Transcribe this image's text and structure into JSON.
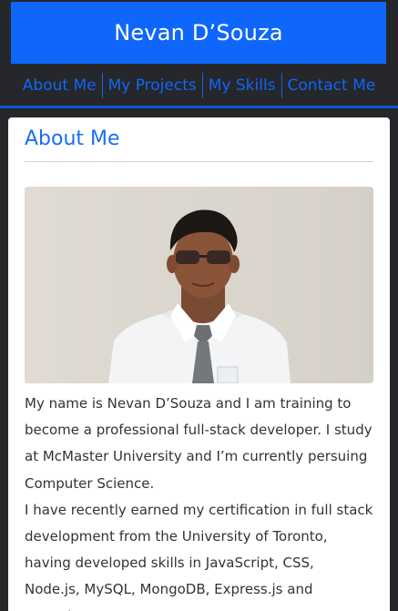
{
  "header": {
    "title": "Nevan D’Souza"
  },
  "nav": {
    "items": [
      {
        "label": "About Me"
      },
      {
        "label": "My Projects"
      },
      {
        "label": "My Skills"
      },
      {
        "label": "Contact Me"
      }
    ]
  },
  "about": {
    "title": "About Me",
    "photo_icon": "profile-photo",
    "paragraph1": "My name is Nevan D’Souza and I am training to become a professional full-stack developer. I study at McMaster University and I’m currently persuing Computer Science.",
    "paragraph2": "I have recently earned my certification in full stack development from the University of Toronto, having developed skills in JavaScript, CSS, Node.js, MySQL, MongoDB, Express.js and React.js."
  },
  "colors": {
    "brand": "#0f66fb",
    "background": "#25272a",
    "card": "#ffffff",
    "text": "#333333"
  }
}
